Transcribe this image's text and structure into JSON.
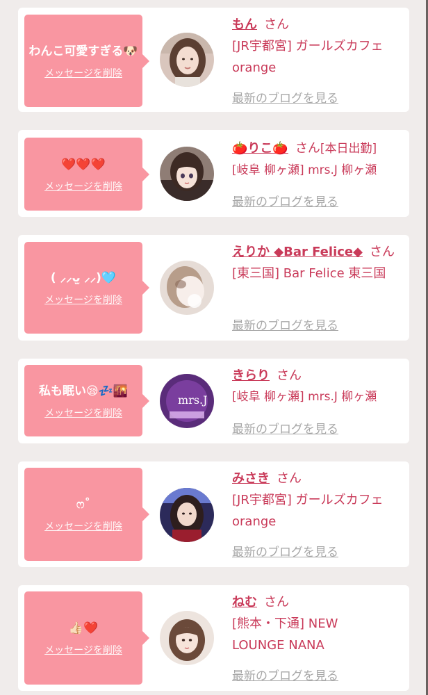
{
  "delete_label": "メッセージを削除",
  "blog_label": "最新のブログを見る",
  "san_label": "さん",
  "messages": [
    {
      "text": "わんこ可愛すぎる🐶",
      "cast_name": "もん",
      "suffix": "",
      "store": "[JR宇都宮] ガールズカフェ orange",
      "avatar_icon": "woman-portrait-icon"
    },
    {
      "text": "❤️❤️❤️",
      "cast_name": "🍅りこ🍅",
      "suffix": "[本日出勤]",
      "store": "[岐阜 柳ヶ瀬] mrs.J 柳ヶ瀬",
      "avatar_icon": "anime-girl-icon"
    },
    {
      "text": "( ⸝⸝ᴗ̫ ⸝⸝)🩵",
      "cast_name": "えりか ◆Bar Felice◆",
      "suffix": "",
      "store": "[東三国] Bar Felice 東三国",
      "avatar_icon": "blurred-portrait-icon"
    },
    {
      "text": "私も眠い😪💤🌇",
      "cast_name": "きらり",
      "suffix": "",
      "store": "[岐阜 柳ヶ瀬] mrs.J 柳ヶ瀬",
      "avatar_icon": "store-logo-icon"
    },
    {
      "text": "ෆ˚",
      "cast_name": "みさき",
      "suffix": "",
      "store": "[JR宇都宮] ガールズカフェ orange",
      "avatar_icon": "woman-portrait-icon"
    },
    {
      "text": "👍🏻❤️",
      "cast_name": "ねむ",
      "suffix": "",
      "store": "[熊本・下通] NEW LOUNGE NANA",
      "avatar_icon": "woman-portrait-icon"
    }
  ],
  "logo_text": "mrs.J"
}
